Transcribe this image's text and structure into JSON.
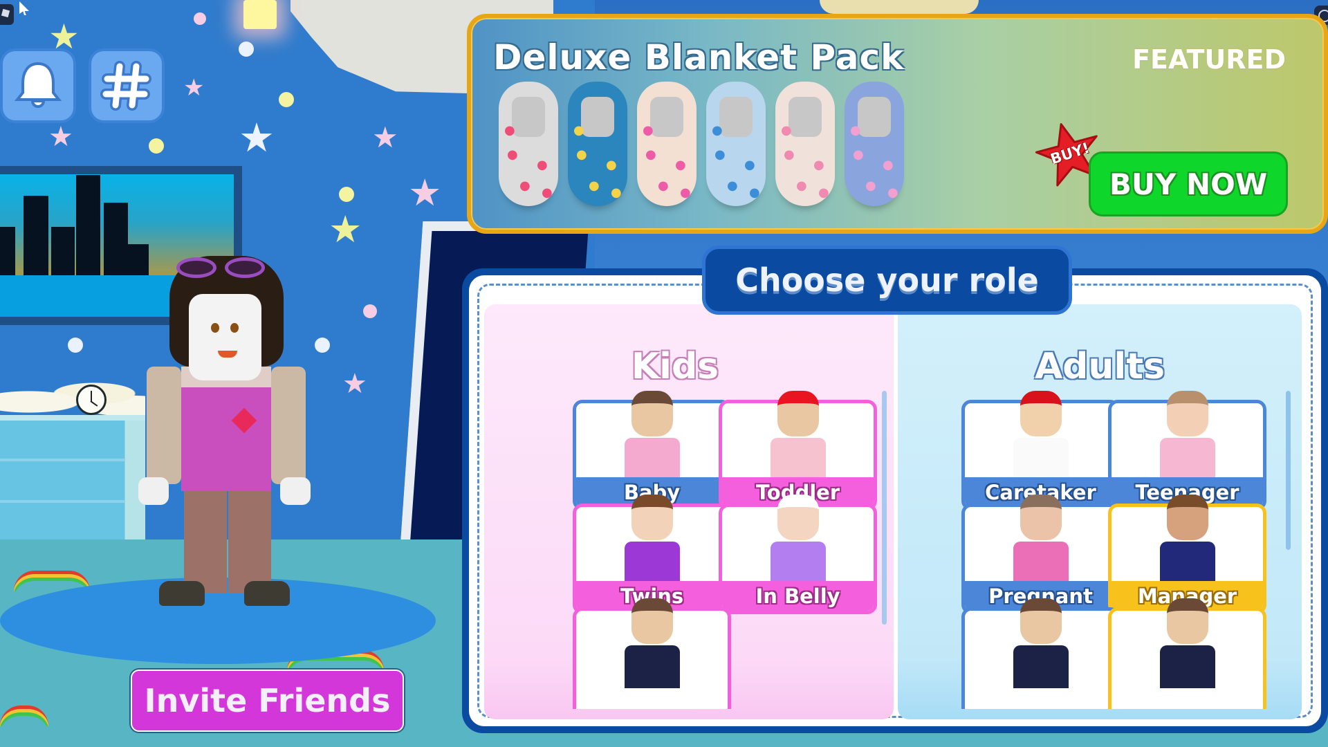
{
  "hud": {
    "notifications_icon": "bell-icon",
    "tag_icon": "hashtag-icon",
    "roblox_menu_icon": "roblox-logo-icon",
    "more_menu_icon": "more-options-icon"
  },
  "featured": {
    "title": "Deluxe Blanket Pack",
    "badge": "FEATURED",
    "buy_star_label": "BUY!",
    "buy_button_label": "BUY NOW",
    "items": [
      {
        "name": "hearts-blanket",
        "color": "#dcdcdc",
        "pattern_color": "#ef4d78"
      },
      {
        "name": "space-blanket",
        "color": "#2a86bd",
        "pattern_color": "#f4d24a"
      },
      {
        "name": "flowers-blanket",
        "color": "#f3e0d2",
        "pattern_color": "#ee5ca8"
      },
      {
        "name": "clouds-blanket",
        "color": "#b9d6ef",
        "pattern_color": "#3d8ed9"
      },
      {
        "name": "smiley-blanket",
        "color": "#f0e2da",
        "pattern_color": "#f08ab0"
      },
      {
        "name": "rainbow-blanket",
        "color": "#8aa5dd",
        "pattern_color": "#f2a0d0"
      }
    ],
    "colors": {
      "border": "#e7a615",
      "buy_button": "#0fd62a",
      "buy_star": "#e51d24"
    }
  },
  "role_chooser": {
    "title": "Choose your role",
    "kids": {
      "heading": "Kids",
      "roles": [
        {
          "label": "Baby",
          "style": "blue",
          "selected": true
        },
        {
          "label": "Toddler",
          "style": "pink"
        },
        {
          "label": "Twins",
          "style": "pink"
        },
        {
          "label": "In Belly",
          "style": "pink"
        },
        {
          "label": "",
          "style": "pink"
        }
      ]
    },
    "adults": {
      "heading": "Adults",
      "roles": [
        {
          "label": "Caretaker",
          "style": "blue"
        },
        {
          "label": "Teenager",
          "style": "blue"
        },
        {
          "label": "Pregnant",
          "style": "blue"
        },
        {
          "label": "Manager",
          "style": "gold"
        },
        {
          "label": "",
          "style": "blue"
        },
        {
          "label": "",
          "style": "gold"
        }
      ]
    }
  },
  "invite_button_label": "Invite Friends"
}
